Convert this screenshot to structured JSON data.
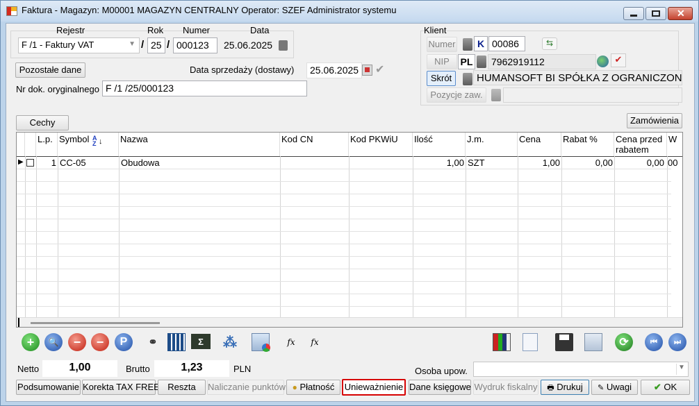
{
  "window": {
    "title": "Faktura - Magazyn: M00001 MAGAZYN CENTRALNY  Operator: SZEF Administrator systemu"
  },
  "header": {
    "rejestr_label": "Rejestr",
    "rejestr_value": "F /1  - Faktury VAT",
    "rok_label": "Rok",
    "rok_value": "25",
    "numer_label": "Numer",
    "numer_value": "000123",
    "data_label": "Data",
    "data_value": "25.06.2025",
    "sep": "/",
    "pozostale_label": "Pozostałe dane",
    "data_sprzedazy_label": "Data sprzedaży (dostawy)",
    "data_sprzedazy_value": "25.06.2025",
    "nr_dok_label": "Nr dok. oryginalnego",
    "nr_dok_value": "F /1  /25/000123"
  },
  "klient": {
    "title": "Klient",
    "numer_label": "Numer",
    "numer_prefix": "K",
    "numer_value": "00086",
    "nip_label": "NIP",
    "nip_prefix": "PL",
    "nip_value": "7962919112",
    "skrot_label": "Skrót",
    "skrot_value": "HUMANSOFT BI SPÓŁKA Z OGRANICZONĄ",
    "pozycje_label": "Pozycje zaw.",
    "pozycje_value": ""
  },
  "buttons": {
    "cechy": "Cechy",
    "zamowienia": "Zamówienia"
  },
  "table": {
    "columns": [
      "L.p.",
      "Symbol",
      "Nazwa",
      "Kod CN",
      "Kod PKWiU",
      "Ilość",
      "J.m.",
      "Cena",
      "Rabat %",
      "Cena przed rabatem",
      "W"
    ],
    "sort_glyph": "AZ",
    "rows": [
      {
        "lp": "1",
        "symbol": "CC-05",
        "nazwa": "Obudowa",
        "kod_cn": "",
        "kod_pkwiu": "",
        "ilosc": "1,00",
        "jm": "SZT",
        "cena": "1,00",
        "rabat": "0,00",
        "cena_przed": "0,00",
        "w": "00"
      }
    ]
  },
  "toolbar": {
    "icons": [
      "add-icon",
      "search-icon",
      "delete-icon",
      "remove-icon",
      "p-icon",
      "binoculars-icon",
      "grid-icon",
      "sigma-icon",
      "molecule-icon",
      "window-icon",
      "fx-icon",
      "fx-icon",
      "chart-icon",
      "document-icon",
      "save-icon",
      "copy-icon",
      "refresh-icon",
      "prev-icon",
      "next-icon"
    ],
    "fx": "fx",
    "p": "P"
  },
  "totals": {
    "netto_label": "Netto",
    "netto_value": "1,00",
    "brutto_label": "Brutto",
    "brutto_value": "1,23",
    "currency": "PLN",
    "osoba_label": "Osoba upow.",
    "osoba_value": ""
  },
  "bottom": {
    "podsumowanie": "Podsumowanie",
    "korekta": "Korekta TAX FREE",
    "reszta": "Reszta",
    "naliczanie": "Naliczanie punktów",
    "platnosc": "Płatność",
    "uniewaznienie": "Unieważnienie",
    "dane_ksiegowe": "Dane księgowe",
    "wydruk": "Wydruk fiskalny",
    "drukuj": "Drukuj",
    "uwagi": "Uwagi",
    "ok": "OK"
  },
  "colors": {
    "accent_red": "#d60000",
    "link_blue": "#0a3c8c",
    "ok_green": "#3a9d23"
  }
}
